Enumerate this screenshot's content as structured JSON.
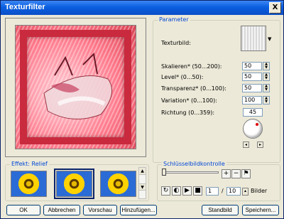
{
  "window": {
    "title": "Texturfilter",
    "close": "X"
  },
  "params": {
    "group_label": "Parameter",
    "texture_label": "Texturbild:",
    "fields": [
      {
        "label": "Skalieren* (50...200):",
        "value": "50"
      },
      {
        "label": "Level* (0...50):",
        "value": "50"
      },
      {
        "label": "Transparenz* (0...100):",
        "value": "50"
      },
      {
        "label": "Variation* (0...100):",
        "value": "100"
      }
    ],
    "direction_label": "Richtung (0...359):",
    "direction_value": "45"
  },
  "effect": {
    "group_label": "Effekt: Relief"
  },
  "keyframe": {
    "group_label": "Schlüsselbildkontrolle",
    "frame_current": "1",
    "frame_sep": "/",
    "frame_total": "10",
    "frames_label": "Bilder"
  },
  "buttons": {
    "ok": "OK",
    "cancel": "Abbrechen",
    "preview": "Vorschau",
    "add": "Hinzufügen...",
    "still": "Standbild",
    "save": "Speichern..."
  },
  "colors": {
    "title_bar": "#0a5fe0",
    "group_label": "#0046d5",
    "frame": "#c92a3d"
  }
}
